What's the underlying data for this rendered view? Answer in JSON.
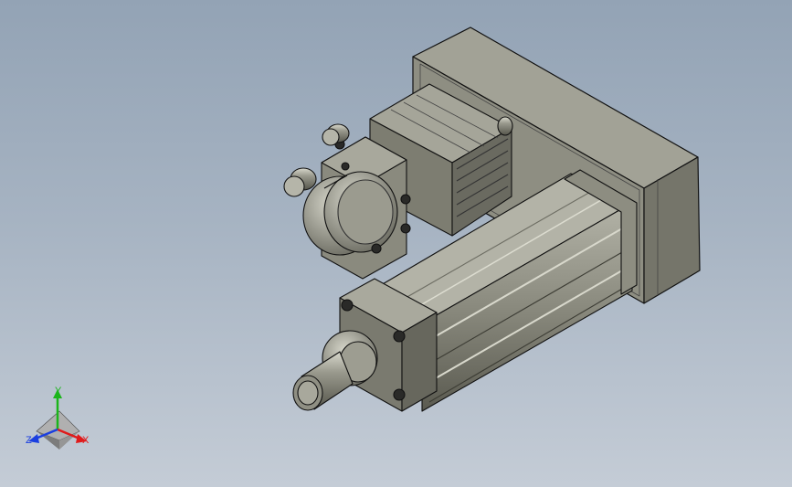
{
  "viewport": {
    "background_top": "#93a3b5",
    "background_bottom": "#c4ccd6"
  },
  "model": {
    "body_color": "#8a8a7e",
    "shade_color": "#5e5e54",
    "highlight_color": "#c8c8bc",
    "outline_color": "#111111"
  },
  "triad": {
    "x_label": "X",
    "y_label": "Y",
    "z_label": "Z",
    "x_color": "#e01b1b",
    "y_color": "#1bb51b",
    "z_color": "#1b3fe0"
  }
}
